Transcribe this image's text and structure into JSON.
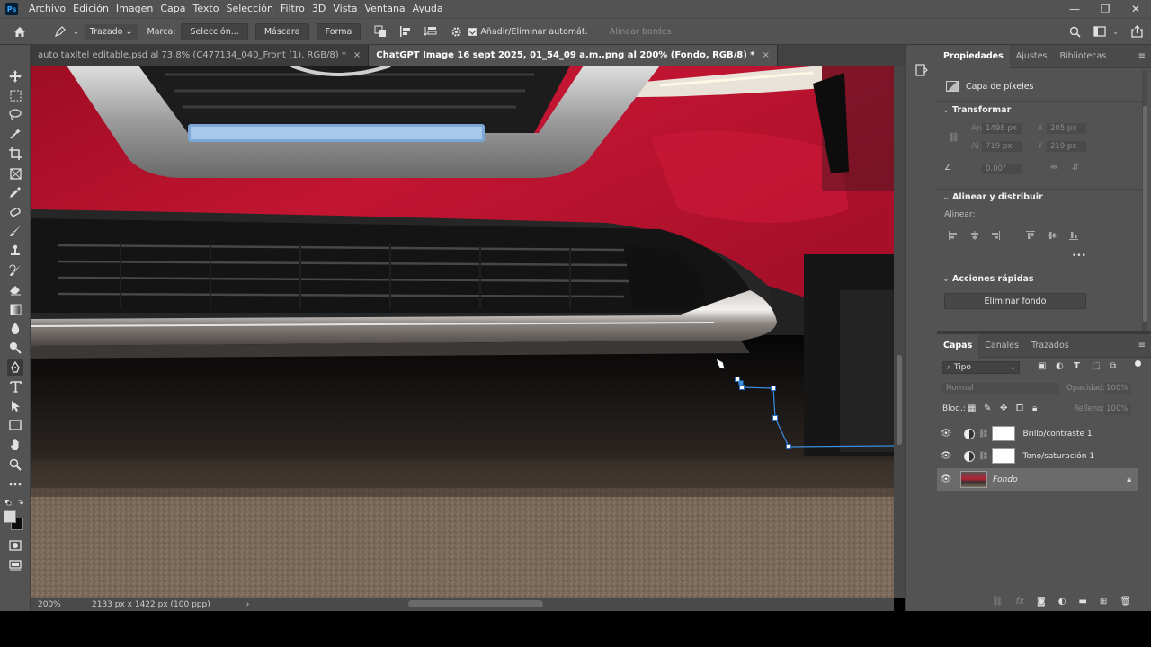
{
  "menubar": {
    "logo": "Ps",
    "items": [
      "Archivo",
      "Edición",
      "Imagen",
      "Capa",
      "Texto",
      "Selección",
      "Filtro",
      "3D",
      "Vista",
      "Ventana",
      "Ayuda"
    ],
    "window_controls": [
      "—",
      "❐",
      "✕"
    ]
  },
  "options": {
    "tool_mode": "Trazado",
    "marca_label": "Marca:",
    "seleccion_btn": "Selección...",
    "mascara_btn": "Máscara",
    "forma_btn": "Forma",
    "auto_add_delete": "Añadir/Eliminar automát.",
    "align_edges": "Alinear bordes"
  },
  "tabs": [
    {
      "label": "auto taxitel editable.psd al 73.8% (C477134_040_Front (1), RGB/8) *",
      "close": "×",
      "active": false
    },
    {
      "label": "ChatGPT Image 16 sept 2025, 01_54_09 a.m..png al 200% (Fondo, RGB/8) *",
      "close": "×",
      "active": true
    }
  ],
  "status": {
    "zoom": "200%",
    "doc_size": "2133 px x 1422 px (100 ppp)",
    "arrow": "›"
  },
  "properties_panel": {
    "tabs": [
      "Propiedades",
      "Ajustes",
      "Bibliotecas"
    ],
    "layer_type": "Capa de píxeles",
    "transform": {
      "title": "Transformar",
      "an_label": "An",
      "an_value": "1498 px",
      "x_label": "X",
      "x_value": "205 px",
      "al_label": "Al",
      "al_value": "719 px",
      "y_label": "Y",
      "y_value": "219 px",
      "angle_value": "0.00°"
    },
    "align": {
      "title": "Alinear y distribuir",
      "align_label": "Alinear:",
      "more": "•••"
    },
    "quick_actions": {
      "title": "Acciones rápidas",
      "remove_bg": "Eliminar fondo"
    }
  },
  "layers_panel": {
    "tabs": [
      "Capas",
      "Canales",
      "Trazados"
    ],
    "filter_type": "Tipo",
    "blend_mode": "Normal",
    "opacity_label": "Opacidad:",
    "opacity_value": "100%",
    "lock_label": "Bloq.:",
    "fill_label": "Relleno:",
    "fill_value": "100%",
    "layers": [
      {
        "name": "Brillo/contraste 1",
        "kind": "adjustment"
      },
      {
        "name": "Tono/saturación 1",
        "kind": "adjustment"
      },
      {
        "name": "Fondo",
        "kind": "image",
        "locked": true,
        "selected": true
      }
    ]
  },
  "colors": {
    "ui_dark": "#535353",
    "car_red": "#b0142c",
    "path_blue": "#3a8dde"
  }
}
